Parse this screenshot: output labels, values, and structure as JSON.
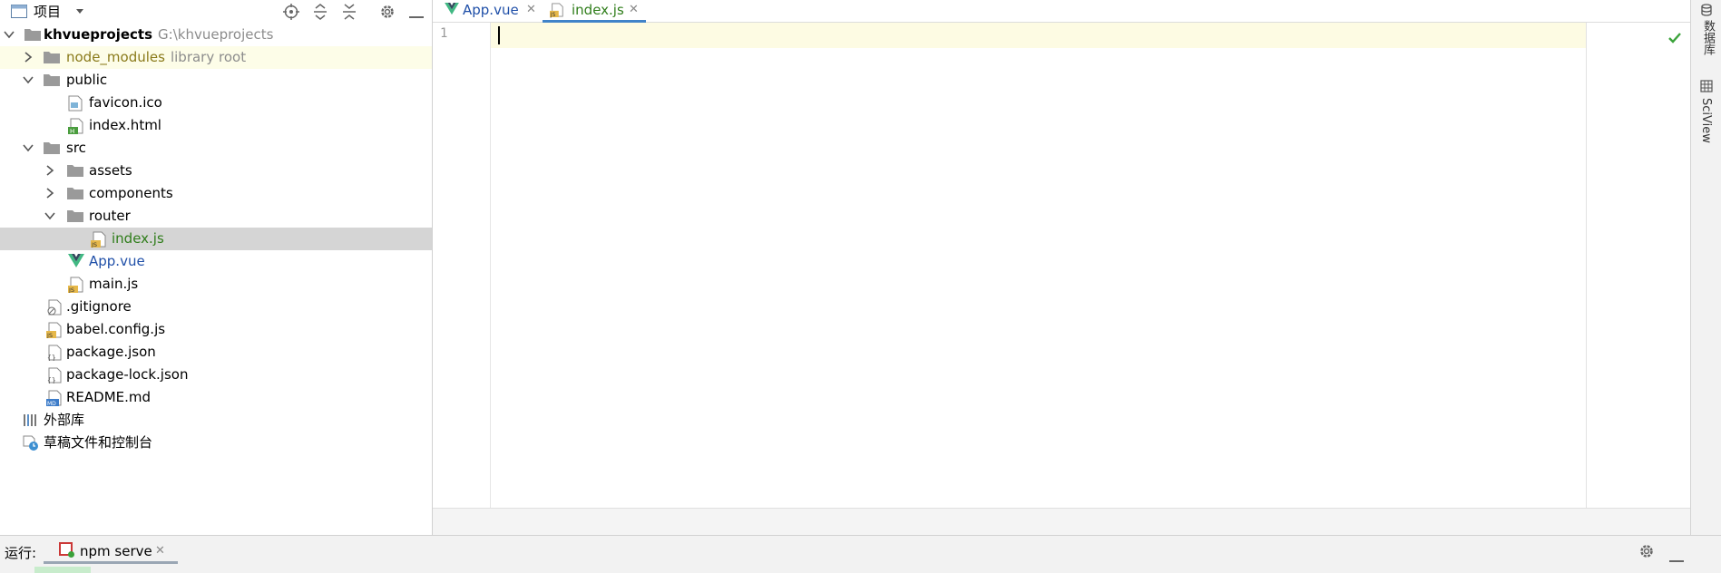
{
  "project_panel": {
    "header": {
      "title": "项目",
      "icons": [
        "locate-icon",
        "expand-all-icon",
        "collapse-all-icon",
        "gear-icon",
        "hide-icon"
      ]
    },
    "tree": [
      {
        "label": "khvueprojects",
        "hint": "G:\\khvueprojects",
        "icon": "folder-icon",
        "expanded": true
      },
      {
        "label": "node_modules",
        "hint": "library root",
        "icon": "folder-icon",
        "expanded": false
      },
      {
        "label": "public",
        "icon": "folder-icon",
        "expanded": true
      },
      {
        "label": "favicon.ico",
        "icon": "image-file-icon"
      },
      {
        "label": "index.html",
        "icon": "html-file-icon"
      },
      {
        "label": "src",
        "icon": "folder-icon",
        "expanded": true
      },
      {
        "label": "assets",
        "icon": "folder-icon",
        "expanded": false
      },
      {
        "label": "components",
        "icon": "folder-icon",
        "expanded": false
      },
      {
        "label": "router",
        "icon": "folder-icon",
        "expanded": true
      },
      {
        "label": "index.js",
        "icon": "js-file-icon",
        "selected": true
      },
      {
        "label": "App.vue",
        "icon": "vue-file-icon"
      },
      {
        "label": "main.js",
        "icon": "js-file-icon"
      },
      {
        "label": ".gitignore",
        "icon": "gitignore-file-icon"
      },
      {
        "label": "babel.config.js",
        "icon": "js-file-icon"
      },
      {
        "label": "package.json",
        "icon": "json-file-icon"
      },
      {
        "label": "package-lock.json",
        "icon": "json-file-icon"
      },
      {
        "label": "README.md",
        "icon": "markdown-file-icon"
      },
      {
        "label": "外部库",
        "icon": "library-icon"
      },
      {
        "label": "草稿文件和控制台",
        "icon": "scratches-icon"
      }
    ]
  },
  "editor": {
    "tabs": [
      {
        "label": "App.vue",
        "icon": "vue-file-icon",
        "active": false
      },
      {
        "label": "index.js",
        "icon": "js-file-icon",
        "active": true
      }
    ],
    "line_numbers": [
      "1"
    ],
    "status_icon": "check-icon"
  },
  "right_sidebar": {
    "items": [
      {
        "label": "数据库",
        "icon": "database-icon"
      },
      {
        "label": "SciView",
        "icon": "sciview-icon"
      }
    ]
  },
  "run_bar": {
    "label": "运行:",
    "tab_label": "npm serve",
    "icons": [
      "gear-icon",
      "hide-icon"
    ]
  },
  "colors": {
    "selected_row": "#d5d5d5",
    "library_row": "#fdfde8",
    "current_line": "#fdfbe3",
    "tab_accent": "#4083c9",
    "vcs_green": "#2f7d1a",
    "vcs_blue": "#1f4fa8"
  }
}
